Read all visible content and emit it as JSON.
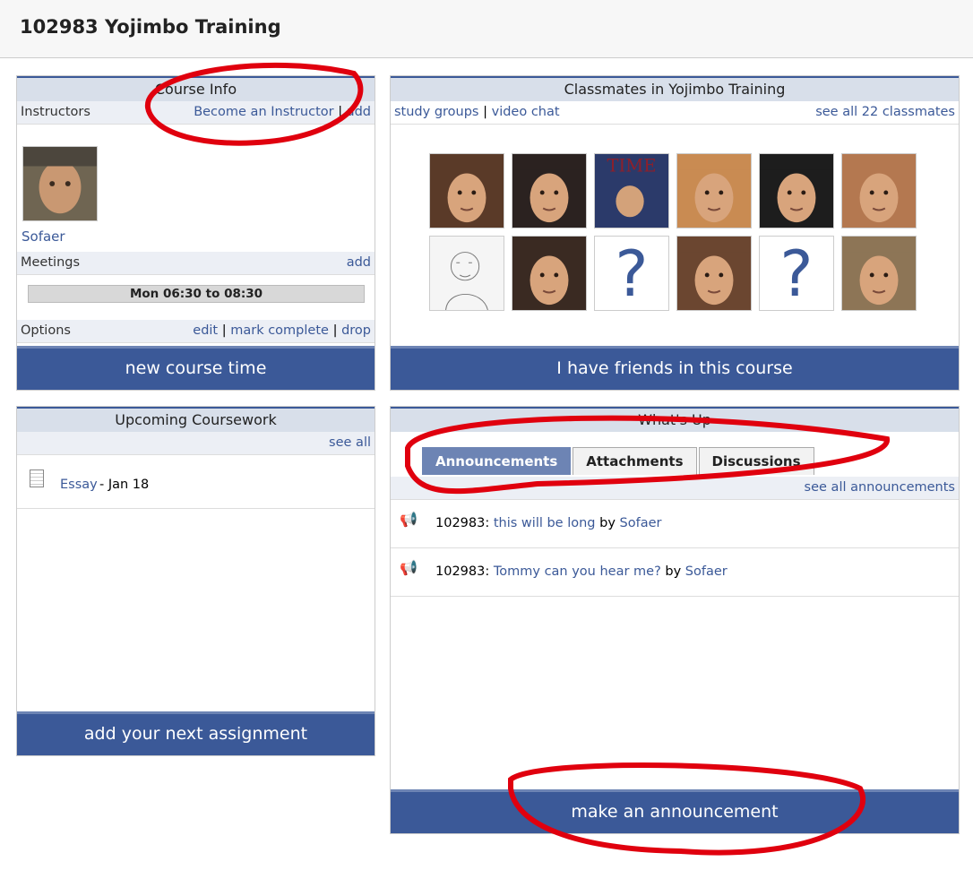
{
  "page": {
    "title": "102983 Yojimbo Training"
  },
  "course_info": {
    "title": "Course Info",
    "instructors_label": "Instructors",
    "become_instructor": "Become an Instructor",
    "add": "add",
    "instructor_name": "Sofaer",
    "meetings_label": "Meetings",
    "meetings_add": "add",
    "meeting_time": "Mon 06:30 to 08:30",
    "options_label": "Options",
    "edit": "edit",
    "mark_complete": "mark complete",
    "drop": "drop",
    "sep": "|",
    "new_course_time": "new course time"
  },
  "classmates": {
    "title": "Classmates in Yojimbo Training",
    "study_groups": "study groups",
    "video_chat": "video chat",
    "see_all": "see all 22 classmates",
    "sep": "|",
    "photos": [
      {
        "kind": "face",
        "bg": "#5a3a28"
      },
      {
        "kind": "face",
        "bg": "#2b2220"
      },
      {
        "kind": "time",
        "label": "TIME",
        "bg": "#8e1f2a"
      },
      {
        "kind": "face",
        "bg": "#c98b52"
      },
      {
        "kind": "face",
        "bg": "#1d1d1d"
      },
      {
        "kind": "face",
        "bg": "#b47850"
      },
      {
        "kind": "sketch",
        "bg": "#f5f5f5"
      },
      {
        "kind": "face",
        "bg": "#3a2a22"
      },
      {
        "kind": "unknown",
        "label": "?"
      },
      {
        "kind": "face",
        "bg": "#6b4630"
      },
      {
        "kind": "unknown",
        "label": "?"
      },
      {
        "kind": "face",
        "bg": "#8d7556"
      }
    ],
    "friends_button": "I have friends in this course"
  },
  "coursework": {
    "title": "Upcoming Coursework",
    "see_all": "see all",
    "item_link": "Essay",
    "item_date": " - Jan 18",
    "add_button": "add your next assignment"
  },
  "whats_up": {
    "title": "What's Up",
    "tabs": [
      "Announcements",
      "Attachments",
      "Discussions"
    ],
    "see_all": "see all announcements",
    "announcements": [
      {
        "course": "102983:",
        "link": "this will be long",
        "by": "by",
        "author": "Sofaer"
      },
      {
        "course": "102983:",
        "link": "Tommy can you hear me?",
        "by": "by",
        "author": "Sofaer"
      }
    ],
    "make_button": "make an announcement"
  },
  "colors": {
    "brand": "#3b5998",
    "annotation": "#e0000e"
  },
  "icons": {
    "announcement": "megaphone-icon",
    "assignment": "document-icon"
  }
}
